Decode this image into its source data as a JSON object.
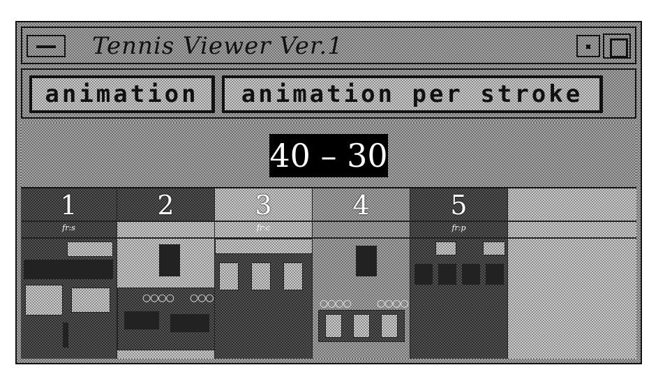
{
  "window": {
    "title": "Tennis Viewer  Ver.1"
  },
  "titlebar": {
    "menu_icon": "window-menu-icon",
    "minimize_icon": "minimize-icon",
    "maximize_icon": "maximize-icon"
  },
  "buttons": {
    "animation": "animation",
    "animation_per_stroke": "animation per stroke"
  },
  "score": "40 – 30",
  "strokes": [
    {
      "number": "1",
      "label": "fr:s"
    },
    {
      "number": "2",
      "label": ""
    },
    {
      "number": "3",
      "label": "fr:c"
    },
    {
      "number": "4",
      "label": ""
    },
    {
      "number": "5",
      "label": "fr:p"
    }
  ]
}
